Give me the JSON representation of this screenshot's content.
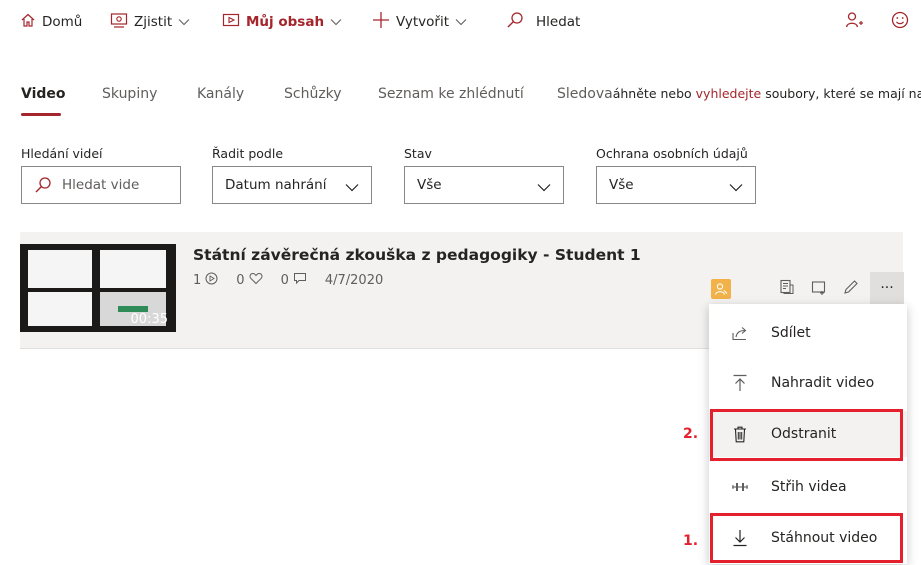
{
  "topnav": {
    "home": "Domů",
    "discover": "Zjistit",
    "my_content": "Můj obsah",
    "create": "Vytvořit",
    "search": "Hledat"
  },
  "tabs": {
    "video": "Video",
    "groups": "Skupiny",
    "channels": "Kanály",
    "meetings": "Schůzky",
    "watchlist": "Seznam ke zhlédnutí",
    "followed": "Sledova",
    "hint_prefix": "áhněte nebo ",
    "hint_link": "vyhledejte",
    "hint_suffix": " soubory, které se mají nahrát."
  },
  "filters": {
    "search_label": "Hledání videí",
    "search_placeholder": "Hledat vide",
    "sort_label": "Řadit podle",
    "sort_value": "Datum nahrání",
    "status_label": "Stav",
    "status_value": "Vše",
    "privacy_label": "Ochrana osobních údajů",
    "privacy_value": "Vše"
  },
  "video": {
    "title": "Státní závěrečná zkouška z pedagogiky - Student 1",
    "views": "1",
    "likes": "0",
    "comments": "0",
    "date": "4/7/2020",
    "duration": "00:35"
  },
  "menu": {
    "share": "Sdílet",
    "replace": "Nahradit video",
    "delete": "Odstranit",
    "trim": "Střih videa",
    "download": "Stáhnout video"
  },
  "annotations": {
    "step_delete": "2.",
    "step_download": "1."
  },
  "colors": {
    "accent": "#a4262c",
    "annotation": "#e3202b",
    "owner_badge": "#f2b24a"
  }
}
